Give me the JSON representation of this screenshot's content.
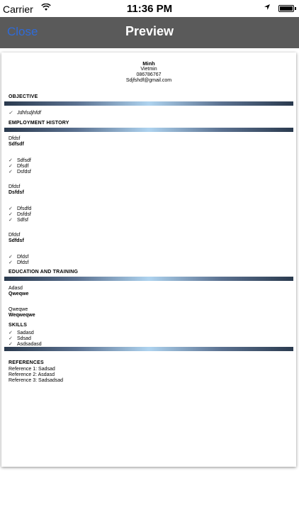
{
  "status_bar": {
    "carrier": "Carrier",
    "time": "11:36 PM"
  },
  "navbar": {
    "close_label": "Close",
    "title": "Preview"
  },
  "resume": {
    "name": "Minh",
    "country": "Vietmin",
    "phone": "086786767",
    "email": "Sdjfshdf@gmail.com",
    "objective": {
      "title": "OBJECTIVE",
      "items": [
        "Jdhfsdjhfdf"
      ]
    },
    "employment": {
      "title": "EMPLOYMENT HISTORY",
      "jobs": [
        {
          "company": "Dfdsf",
          "position": "Sdfsdf",
          "duties": [
            "Sdfsdf",
            "Dfsdf",
            "Dsfdsf"
          ]
        },
        {
          "company": "Dfdsf",
          "position": "Dsfdsf",
          "duties": [
            "Dfsdfd",
            "Dsfdsf",
            "Sdfsf"
          ]
        },
        {
          "company": "Dfdsf",
          "position": "Sdfdsf",
          "duties": [
            "Dfdsf",
            "Dfdsf"
          ]
        }
      ]
    },
    "education": {
      "title": "EDUCATION AND TRAINING",
      "entries": [
        {
          "school": "Adasd",
          "degree": "Qweqwe"
        },
        {
          "school": "Qweqwe",
          "degree": "Weqweqwe"
        }
      ]
    },
    "skills": {
      "title": "SKILLS",
      "items": [
        "Sadasd",
        "Sdsad",
        "Asdsadasd"
      ]
    },
    "references": {
      "title": "REFERENCES",
      "items": [
        "Reference 1: Sadsad",
        "Reference 2: Asdasd",
        "Reference 3: Sadsadsad"
      ]
    },
    "check_mark": "✓"
  }
}
